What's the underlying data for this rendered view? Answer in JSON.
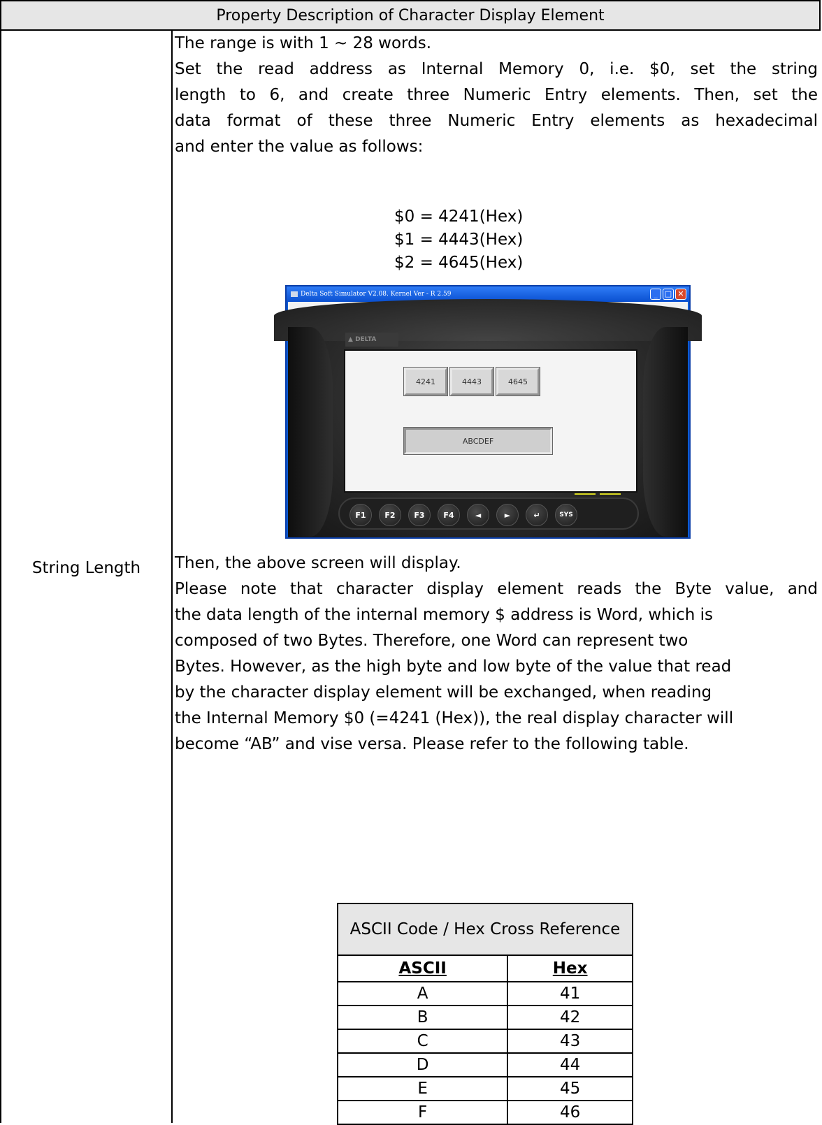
{
  "header": {
    "title": "Property Description of Character Display Element"
  },
  "row_label": "String Length",
  "intro": "The range is with 1 ~ 28 words.",
  "para1_lines": [
    "Set the read address as Internal Memory 0, i.e. $0, set the string",
    "length to 6, and create three Numeric Entry elements. Then, set the",
    "data format of these three Numeric Entry elements as hexadecimal",
    "and enter the value as follows:"
  ],
  "equations": [
    "$0 = 4241(Hex)",
    "$1 = 4443(Hex)",
    "$2 = 4645(Hex)"
  ],
  "simulator": {
    "title": "Delta Soft Simulator V2.08. Kernel Ver - R 2.59",
    "logo": "DELTA",
    "numeric_entries": [
      "4241",
      "4443",
      "4645"
    ],
    "character_display": "ABCDEF",
    "keys": [
      "F1",
      "F2",
      "F3",
      "F4",
      "◄",
      "►",
      "↵",
      "SYS"
    ]
  },
  "after_image": "Then, the above screen will display.",
  "para2_lines": [
    "Please note that character display element reads the Byte value, and",
    "the data length of the internal memory $ address is Word, which is",
    "composed of two Bytes. Therefore, one Word can represent two",
    "Bytes. However, as the high byte and low byte of the value that read",
    "by the character display element will be exchanged, when reading",
    "the Internal Memory $0 (=4241 (Hex)), the real display character will",
    "become “AB” and vise versa. Please refer to the following table."
  ],
  "ascii_table": {
    "caption": "ASCII Code / Hex Cross Reference",
    "headers": [
      "ASCII",
      "Hex"
    ],
    "rows": [
      [
        "A",
        "41"
      ],
      [
        "B",
        "42"
      ],
      [
        "C",
        "43"
      ],
      [
        "D",
        "44"
      ],
      [
        "E",
        "45"
      ],
      [
        "F",
        "46"
      ]
    ]
  }
}
